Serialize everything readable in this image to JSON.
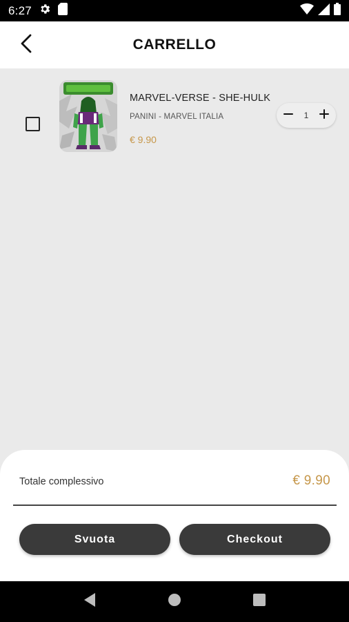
{
  "status_bar": {
    "time": "6:27",
    "icons": [
      "gear-icon",
      "sim-card-icon",
      "wifi-icon",
      "signal-icon",
      "battery-icon"
    ]
  },
  "app_bar": {
    "title": "CARRELLO",
    "back_icon": "chevron-left-icon"
  },
  "cart": {
    "items": [
      {
        "title": "MARVEL-VERSE - SHE-HULK",
        "publisher": "PANINI - MARVEL ITALIA",
        "price": "€ 9.90",
        "quantity": "1",
        "selected": false
      }
    ]
  },
  "summary": {
    "total_label": "Totale complessivo",
    "total_value": "€ 9.90",
    "empty_label": "Svuota",
    "checkout_label": "Checkout"
  },
  "colors": {
    "accent": "#c6974a",
    "button": "#3a3a3a",
    "background": "#eaeaea"
  }
}
